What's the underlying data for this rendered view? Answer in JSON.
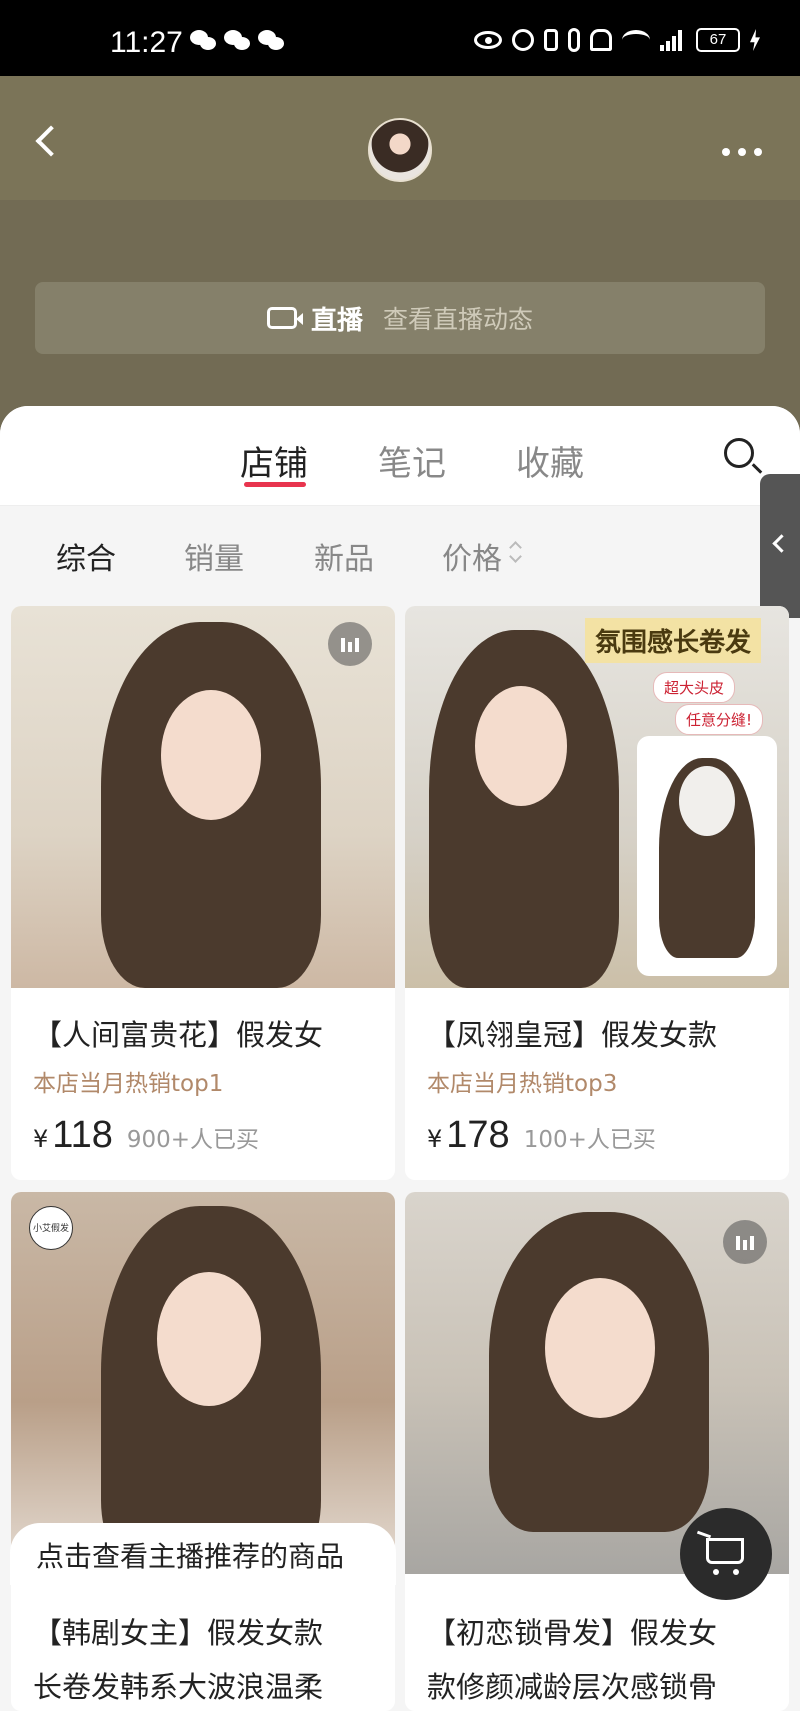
{
  "status_bar": {
    "time": "11:27",
    "battery": "67"
  },
  "header": {
    "back_icon": "chevron-left-icon",
    "more_icon": "more-dots-icon"
  },
  "live_banner": {
    "label": "直播",
    "subtitle": "查看直播动态"
  },
  "tabs": [
    {
      "label": "店铺",
      "active": true
    },
    {
      "label": "笔记",
      "active": false
    },
    {
      "label": "收藏",
      "active": false
    }
  ],
  "filters": [
    {
      "label": "综合",
      "active": true
    },
    {
      "label": "销量",
      "active": false
    },
    {
      "label": "新品",
      "active": false
    },
    {
      "label": "价格",
      "active": false
    }
  ],
  "products": [
    {
      "title": "【人间富贵花】假发女",
      "tag": "本店当月热销top1",
      "currency": "¥",
      "price": "118",
      "sold": "900+人已买"
    },
    {
      "title": "【凤翎皇冠】假发女款",
      "tag": "本店当月热销top3",
      "currency": "¥",
      "price": "178",
      "sold": "100+人已买",
      "promo_title": "氛围感长卷发",
      "promo_tags": [
        "超大头皮",
        "任意分缝!"
      ]
    },
    {
      "title": "【韩剧女主】假发女款",
      "title_line2": "长卷发韩系大波浪温柔",
      "shop_logo_text": "小艾假发"
    },
    {
      "title": "【初恋锁骨发】假发女",
      "title_line2": "款修颜减龄层次感锁骨"
    }
  ],
  "recommend_bar": "点击查看主播推荐的商品",
  "colors": {
    "accent": "#e8344e",
    "header_bg": "#7b7458",
    "tag_color": "#b1896a"
  }
}
